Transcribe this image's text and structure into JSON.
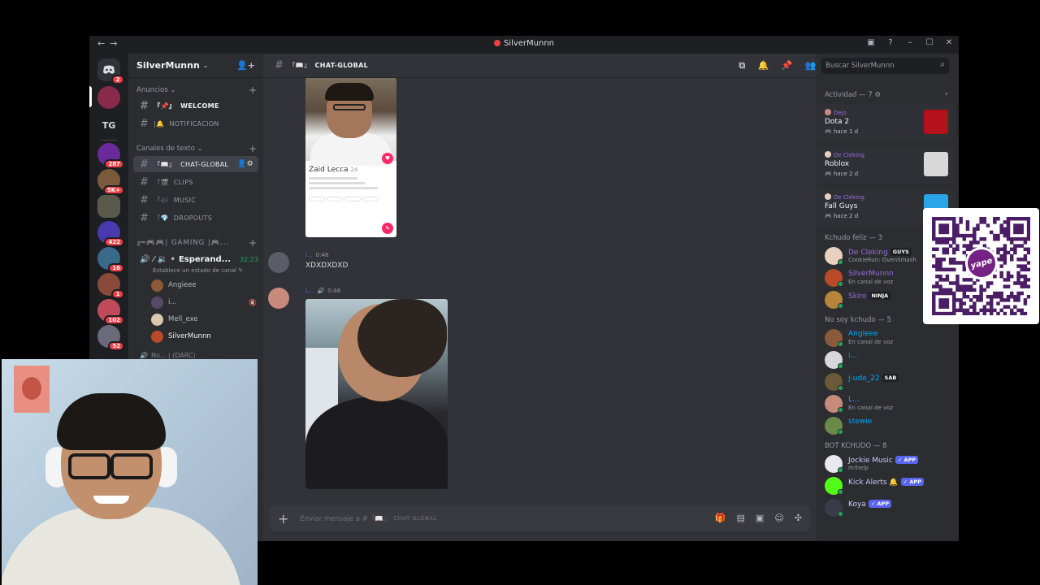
{
  "window": {
    "title": "SilverMunnn"
  },
  "rail": {
    "home_badge": "2",
    "servers": [
      {
        "abbr": "",
        "badge": "",
        "color": "#8a2a4a"
      },
      {
        "abbr": "TG",
        "badge": "",
        "color": "#1e1f22"
      },
      {
        "abbr": "",
        "badge": "287",
        "color": "#6a2a9a"
      },
      {
        "abbr": "",
        "badge": "5K+",
        "color": "#7a5a3a"
      },
      {
        "abbr": "",
        "badge": "",
        "color": "#5a5a4a"
      },
      {
        "abbr": "",
        "badge": "422",
        "color": "#4a3ab0"
      },
      {
        "abbr": "",
        "badge": "16",
        "color": "#3a6a8a"
      },
      {
        "abbr": "",
        "badge": "1",
        "color": "#8a4a3a"
      },
      {
        "abbr": "",
        "badge": "102",
        "color": "#c04a5a"
      },
      {
        "abbr": "",
        "badge": "52",
        "color": "#6a6a7a"
      }
    ]
  },
  "sidebar": {
    "guild_name": "SilverMunnn",
    "categories": {
      "announcements": "Anuncios",
      "text": "Canales de texto",
      "gaming": "╔═🎮🎮| GAMING |🎮..."
    },
    "channels": [
      {
        "prefix": "『📌』",
        "name": "WELCOME"
      },
      {
        "prefix": "|🔔",
        "name": "NOTIFICACION"
      },
      {
        "prefix": "『📖』",
        "name": "CHAT-GLOBAL"
      },
      {
        "prefix": "『🎬",
        "name": "CLIPS"
      },
      {
        "prefix": "『🎶",
        "name": "MUSIC"
      },
      {
        "prefix": "『💎",
        "name": "DROPOUTS"
      }
    ],
    "voice_channel": {
      "name": "Esperand...",
      "timer": "32:23",
      "status": "Establece un estado de canal"
    },
    "voice_users": [
      {
        "name": "Angieee",
        "color": "#8a5a3a"
      },
      {
        "name": "i...",
        "color": "#5a4a6a"
      },
      {
        "name": "Mell_exe",
        "color": "#d8c8b0"
      },
      {
        "name": "SilverMunnn",
        "color": "#b84a2a"
      }
    ],
    "next_voice": "No... | (DARC)"
  },
  "chat": {
    "channel_name": "CHAT-GLOBAL",
    "profile_card": {
      "name": "Zaid Lecca",
      "age": "24"
    },
    "messages": [
      {
        "user": "i...",
        "time": "0:48",
        "text": "XDXDXDXD"
      },
      {
        "user": "L...",
        "time": "0:48",
        "text": ""
      }
    ],
    "composer_placeholder": "Enviar mensaje a #『📖』",
    "composer_channel": "CHAT-GLOBAL"
  },
  "right_panel": {
    "search_placeholder": "Buscar SilverMunnn",
    "activity_header": "Actividad — 7",
    "activities": [
      {
        "who": "Dejo",
        "game": "Dota 2",
        "when": "hace 1 d",
        "icon_color": "#b3121a"
      },
      {
        "who": "De Cleking",
        "game": "Roblox",
        "when": "hace 2 d",
        "icon_color": "#d8d8d8"
      },
      {
        "who": "De Cleking",
        "game": "Fall Guys",
        "when": "hace 2 d",
        "icon_color": "#2aa6e8"
      }
    ],
    "groups": [
      {
        "title": "Kchudo feliz — 3",
        "members": [
          {
            "name": "De Cleking",
            "tag": "GUYS",
            "tag_style": "dark",
            "sub": "CookieRun: OvenSmash",
            "color": "#9b6cde",
            "avatar": "#e8d0c0"
          },
          {
            "name": "SilverMunnn",
            "tag": "",
            "tag_style": "",
            "sub": "En canal de voz",
            "color": "#9b6cde",
            "avatar": "#b84a2a"
          },
          {
            "name": "Skiro",
            "tag": "NINJA",
            "tag_style": "dark",
            "sub": "",
            "color": "#9b6cde",
            "avatar": "#b8843a"
          }
        ]
      },
      {
        "title": "No soy kchudo — 5",
        "members": [
          {
            "name": "Angieee",
            "tag": "",
            "tag_style": "",
            "sub": "En canal de voz",
            "color": "#00a8fc",
            "avatar": "#8a5a3a"
          },
          {
            "name": "i...",
            "tag": "",
            "tag_style": "",
            "sub": "",
            "color": "#00a8fc",
            "avatar": "#d8d8d8"
          },
          {
            "name": "j-ude_22",
            "tag": "SAB",
            "tag_style": "dark",
            "sub": "",
            "color": "#00a8fc",
            "avatar": "#6a5a3a"
          },
          {
            "name": "L...",
            "tag": "",
            "tag_style": "",
            "sub": "En canal de voz",
            "color": "#00a8fc",
            "avatar": "#c88a7a"
          },
          {
            "name": "stewie",
            "tag": "",
            "tag_style": "",
            "sub": "",
            "color": "#00a8fc",
            "avatar": "#6a8a4a"
          }
        ]
      },
      {
        "title": "BOT KCHUDO — 8",
        "members": [
          {
            "name": "Jockie Music",
            "tag": "✓ APP",
            "tag_style": "app",
            "sub": "m!help",
            "color": "#c9cdfb",
            "avatar": "#e8e8ee"
          },
          {
            "name": "Kick Alerts 🔔",
            "tag": "✓ APP",
            "tag_style": "app",
            "sub": "",
            "color": "#c9cdfb",
            "avatar": "#53fc18"
          },
          {
            "name": "Koya",
            "tag": "✓ APP",
            "tag_style": "app",
            "sub": "",
            "color": "#c9cdfb",
            "avatar": "#3a3a4a"
          }
        ]
      }
    ]
  },
  "overlay": {
    "qr_brand": "yape"
  }
}
